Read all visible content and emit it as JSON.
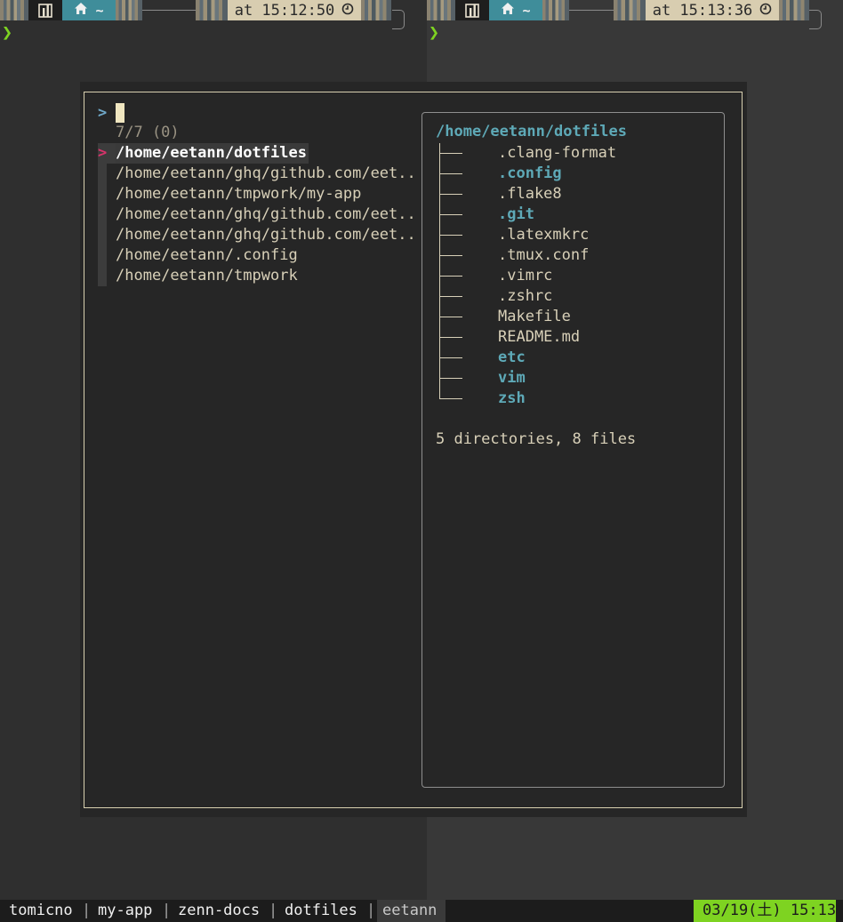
{
  "prompt_left": {
    "home": "~",
    "time": "at 15:12:50"
  },
  "prompt_right": {
    "home": "~",
    "time": "at 15:13:36"
  },
  "prompt_symbol": "❯",
  "finder": {
    "query_symbol": ">",
    "query_value": "",
    "count": "7/7 (0)",
    "pointer": ">",
    "items": [
      "/home/eetann/dotfiles",
      "/home/eetann/ghq/github.com/eet..",
      "/home/eetann/tmpwork/my-app",
      "/home/eetann/ghq/github.com/eet..",
      "/home/eetann/ghq/github.com/eet..",
      "/home/eetann/.config",
      "/home/eetann/tmpwork"
    ]
  },
  "preview": {
    "root": "/home/eetann/dotfiles",
    "entries": [
      {
        "name": ".clang-format",
        "dir": false
      },
      {
        "name": ".config",
        "dir": true
      },
      {
        "name": ".flake8",
        "dir": false
      },
      {
        "name": ".git",
        "dir": true
      },
      {
        "name": ".latexmkrc",
        "dir": false
      },
      {
        "name": ".tmux.conf",
        "dir": false
      },
      {
        "name": ".vimrc",
        "dir": false
      },
      {
        "name": ".zshrc",
        "dir": false
      },
      {
        "name": "Makefile",
        "dir": false
      },
      {
        "name": "README.md",
        "dir": false
      },
      {
        "name": "etc",
        "dir": true
      },
      {
        "name": "vim",
        "dir": true
      },
      {
        "name": "zsh",
        "dir": true
      }
    ],
    "summary": "5 directories, 8 files"
  },
  "tmux": {
    "windows": [
      "tomicno",
      "my-app",
      "zenn-docs",
      "dotfiles",
      "eetann"
    ],
    "separator": "|",
    "clock": "03/19(土) 15:13"
  },
  "colors": {
    "accent_teal": "#5ea9b7",
    "prompt_green": "#7ed321",
    "pointer_pink": "#d8336b"
  }
}
